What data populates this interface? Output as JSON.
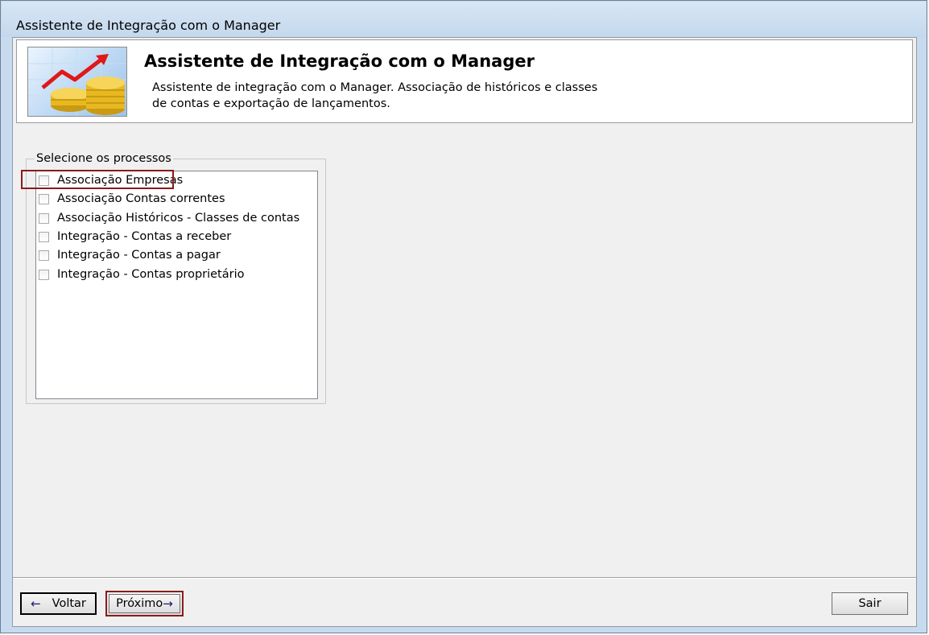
{
  "window": {
    "title": "Assistente de Integração com o Manager"
  },
  "header": {
    "title": "Assistente de Integração com o Manager",
    "description_line1": "Assistente de integração com o Manager. Associação de históricos e classes",
    "description_line2": "de contas e exportação de lançamentos."
  },
  "processes": {
    "legend": "Selecione os processos",
    "items": [
      {
        "label": "Associação Empresas",
        "checked": false
      },
      {
        "label": "Associação Contas correntes",
        "checked": false
      },
      {
        "label": "Associação Históricos - Classes de contas",
        "checked": false
      },
      {
        "label": "Integração - Contas a receber",
        "checked": false
      },
      {
        "label": "Integração - Contas a pagar",
        "checked": false
      },
      {
        "label": "Integração - Contas proprietário",
        "checked": false
      }
    ]
  },
  "buttons": {
    "back_label": "Voltar",
    "back_arrow": "←",
    "next_label": "Próximo",
    "next_arrow": "→",
    "exit_label": "Sair"
  },
  "colors": {
    "highlight": "#8b1a1a",
    "chart_line": "#e01818",
    "coin": "#e8b820"
  },
  "icons": {
    "header_logo": "finance-chart-coins-icon"
  }
}
